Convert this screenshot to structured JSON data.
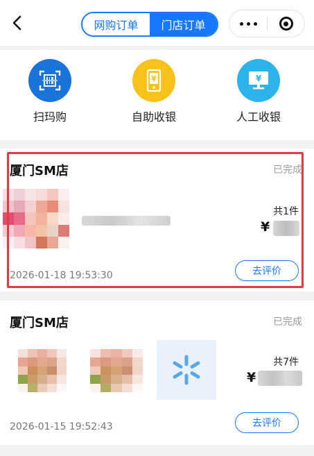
{
  "header": {
    "tabs": [
      {
        "label": "网购订单"
      },
      {
        "label": "门店订单"
      }
    ]
  },
  "actions": [
    {
      "label": "扫玛购",
      "icon": "scan-icon"
    },
    {
      "label": "自助收银",
      "icon": "phone-yen-icon"
    },
    {
      "label": "人工收银",
      "icon": "monitor-yen-icon"
    }
  ],
  "orders": [
    {
      "store": "厦门SM店",
      "status": "已完成",
      "count": "共1件",
      "currency": "¥",
      "date": "2026-01-18 19:53:30",
      "button": "去评价"
    },
    {
      "store": "厦门SM店",
      "status": "已完成",
      "count": "共7件",
      "currency": "¥",
      "date": "2026-01-15 19:52:43",
      "button": "去评价"
    }
  ],
  "colors": {
    "accent": "#1677ff",
    "highlight": "#e53945",
    "scan": "#1a73d9",
    "selfpay": "#f7c21a",
    "manual": "#2bb3ea"
  }
}
